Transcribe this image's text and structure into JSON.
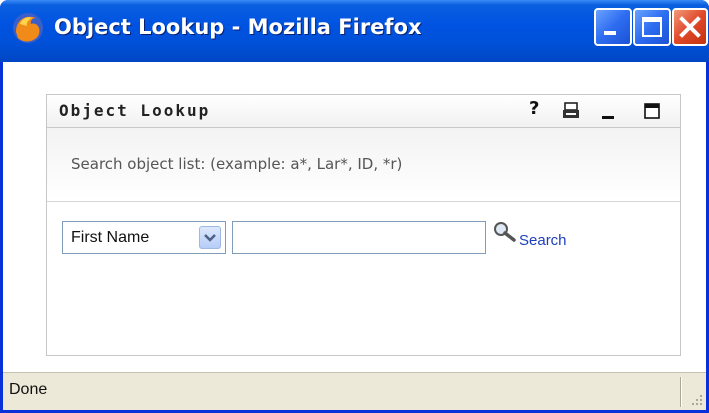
{
  "window": {
    "title": "Object Lookup - Mozilla Firefox",
    "icon": "firefox-icon",
    "controls": [
      "minimize-icon",
      "maximize-icon",
      "close-icon"
    ]
  },
  "portlet": {
    "title": "Object Lookup",
    "header_icons": [
      "help-icon",
      "print-icon",
      "minimize-icon",
      "maximize-icon"
    ],
    "help_glyph": "?",
    "hint": "Search object list: (example: a*, Lar*, ID, *r)",
    "attribute_select": {
      "selected": "First Name"
    },
    "search_input": {
      "value": ""
    },
    "search_link_label": "Search"
  },
  "statusbar": {
    "text": "Done"
  },
  "colors": {
    "titlebar": "#0053e1",
    "link": "#1d3fbd",
    "statusbar_bg": "#ece9d8"
  }
}
